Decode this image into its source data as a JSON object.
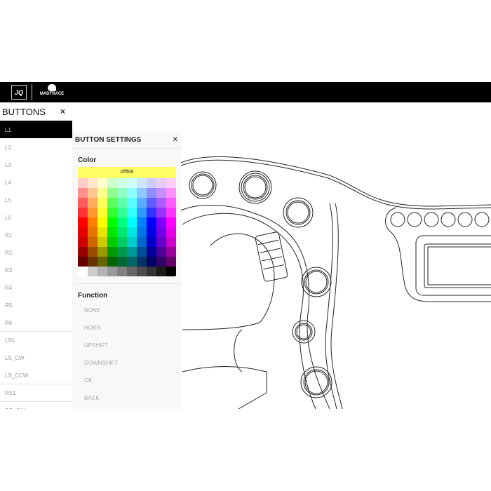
{
  "header": {
    "logo_left": "JQ",
    "logo_right": "MADTRACE"
  },
  "buttons_panel": {
    "title": "BUTTONS",
    "close": "✕",
    "items": [
      {
        "label": "L1",
        "selected": true
      },
      {
        "label": "L2"
      },
      {
        "label": "L3"
      },
      {
        "label": "L4"
      },
      {
        "label": "L5"
      },
      {
        "label": "L6"
      },
      {
        "label": "R1"
      },
      {
        "label": "R2"
      },
      {
        "label": "R3"
      },
      {
        "label": "R4"
      },
      {
        "label": "R5"
      },
      {
        "label": "R6"
      },
      {
        "label": "LS1",
        "divider": true
      },
      {
        "label": "LS_CW"
      },
      {
        "label": "LS_CCW"
      },
      {
        "label": "RS1",
        "divider": true
      },
      {
        "label": "RS_CW",
        "divider": true
      }
    ]
  },
  "settings": {
    "title": "BUTTON SETTINGS",
    "close": "✕",
    "color_label": "Color",
    "color_value": "#ffff66",
    "palette_hues": [
      0,
      30,
      60,
      120,
      150,
      180,
      210,
      240,
      270,
      300
    ],
    "palette_lightness": [
      90,
      78,
      68,
      60,
      50,
      45,
      40,
      30,
      20
    ],
    "palette_grays": [
      "#ffffff",
      "#cccccc",
      "#b3b3b3",
      "#999999",
      "#808080",
      "#666666",
      "#4d4d4d",
      "#333333",
      "#1a1a1a",
      "#000000"
    ],
    "function_label": "Function",
    "functions": [
      "NONE",
      "HORN",
      "UPSHIFT",
      "DOWNSHIFT",
      "OK",
      "BACK"
    ]
  }
}
